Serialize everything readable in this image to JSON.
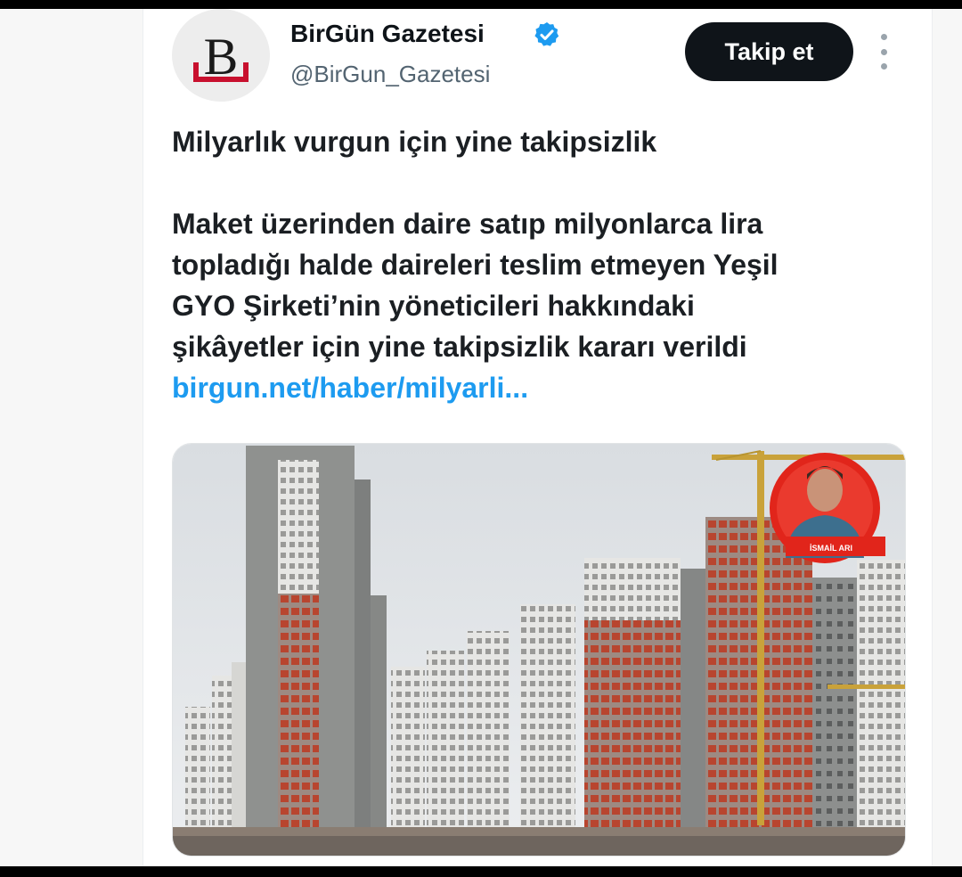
{
  "account": {
    "avatar_letter": "B",
    "display_name": "BirGün Gazetesi",
    "handle": "@BirGun_Gazetesi",
    "verified": true
  },
  "actions": {
    "follow_label": "Takip et",
    "more_icon": "more-vertical-icon"
  },
  "tweet": {
    "headline": "Milyarlık vurgun için yine takipsizlik",
    "body_lines": [
      "Maket üzerinden daire satıp milyonlarca lira",
      "topladığı halde daireleri teslim etmeyen Yeşil",
      "GYO Şirketi’nin yöneticileri hakkındaki",
      "şikâyetler için yine takipsizlik kararı verildi"
    ],
    "link": "birgun.net/haber/milyarli..."
  },
  "media": {
    "reporter_label": "İSMAİL ARI"
  },
  "colors": {
    "link": "#1d9bf0",
    "follow_bg": "#0f1419",
    "verified": "#1d9bf0",
    "brand_red": "#c8102e"
  }
}
